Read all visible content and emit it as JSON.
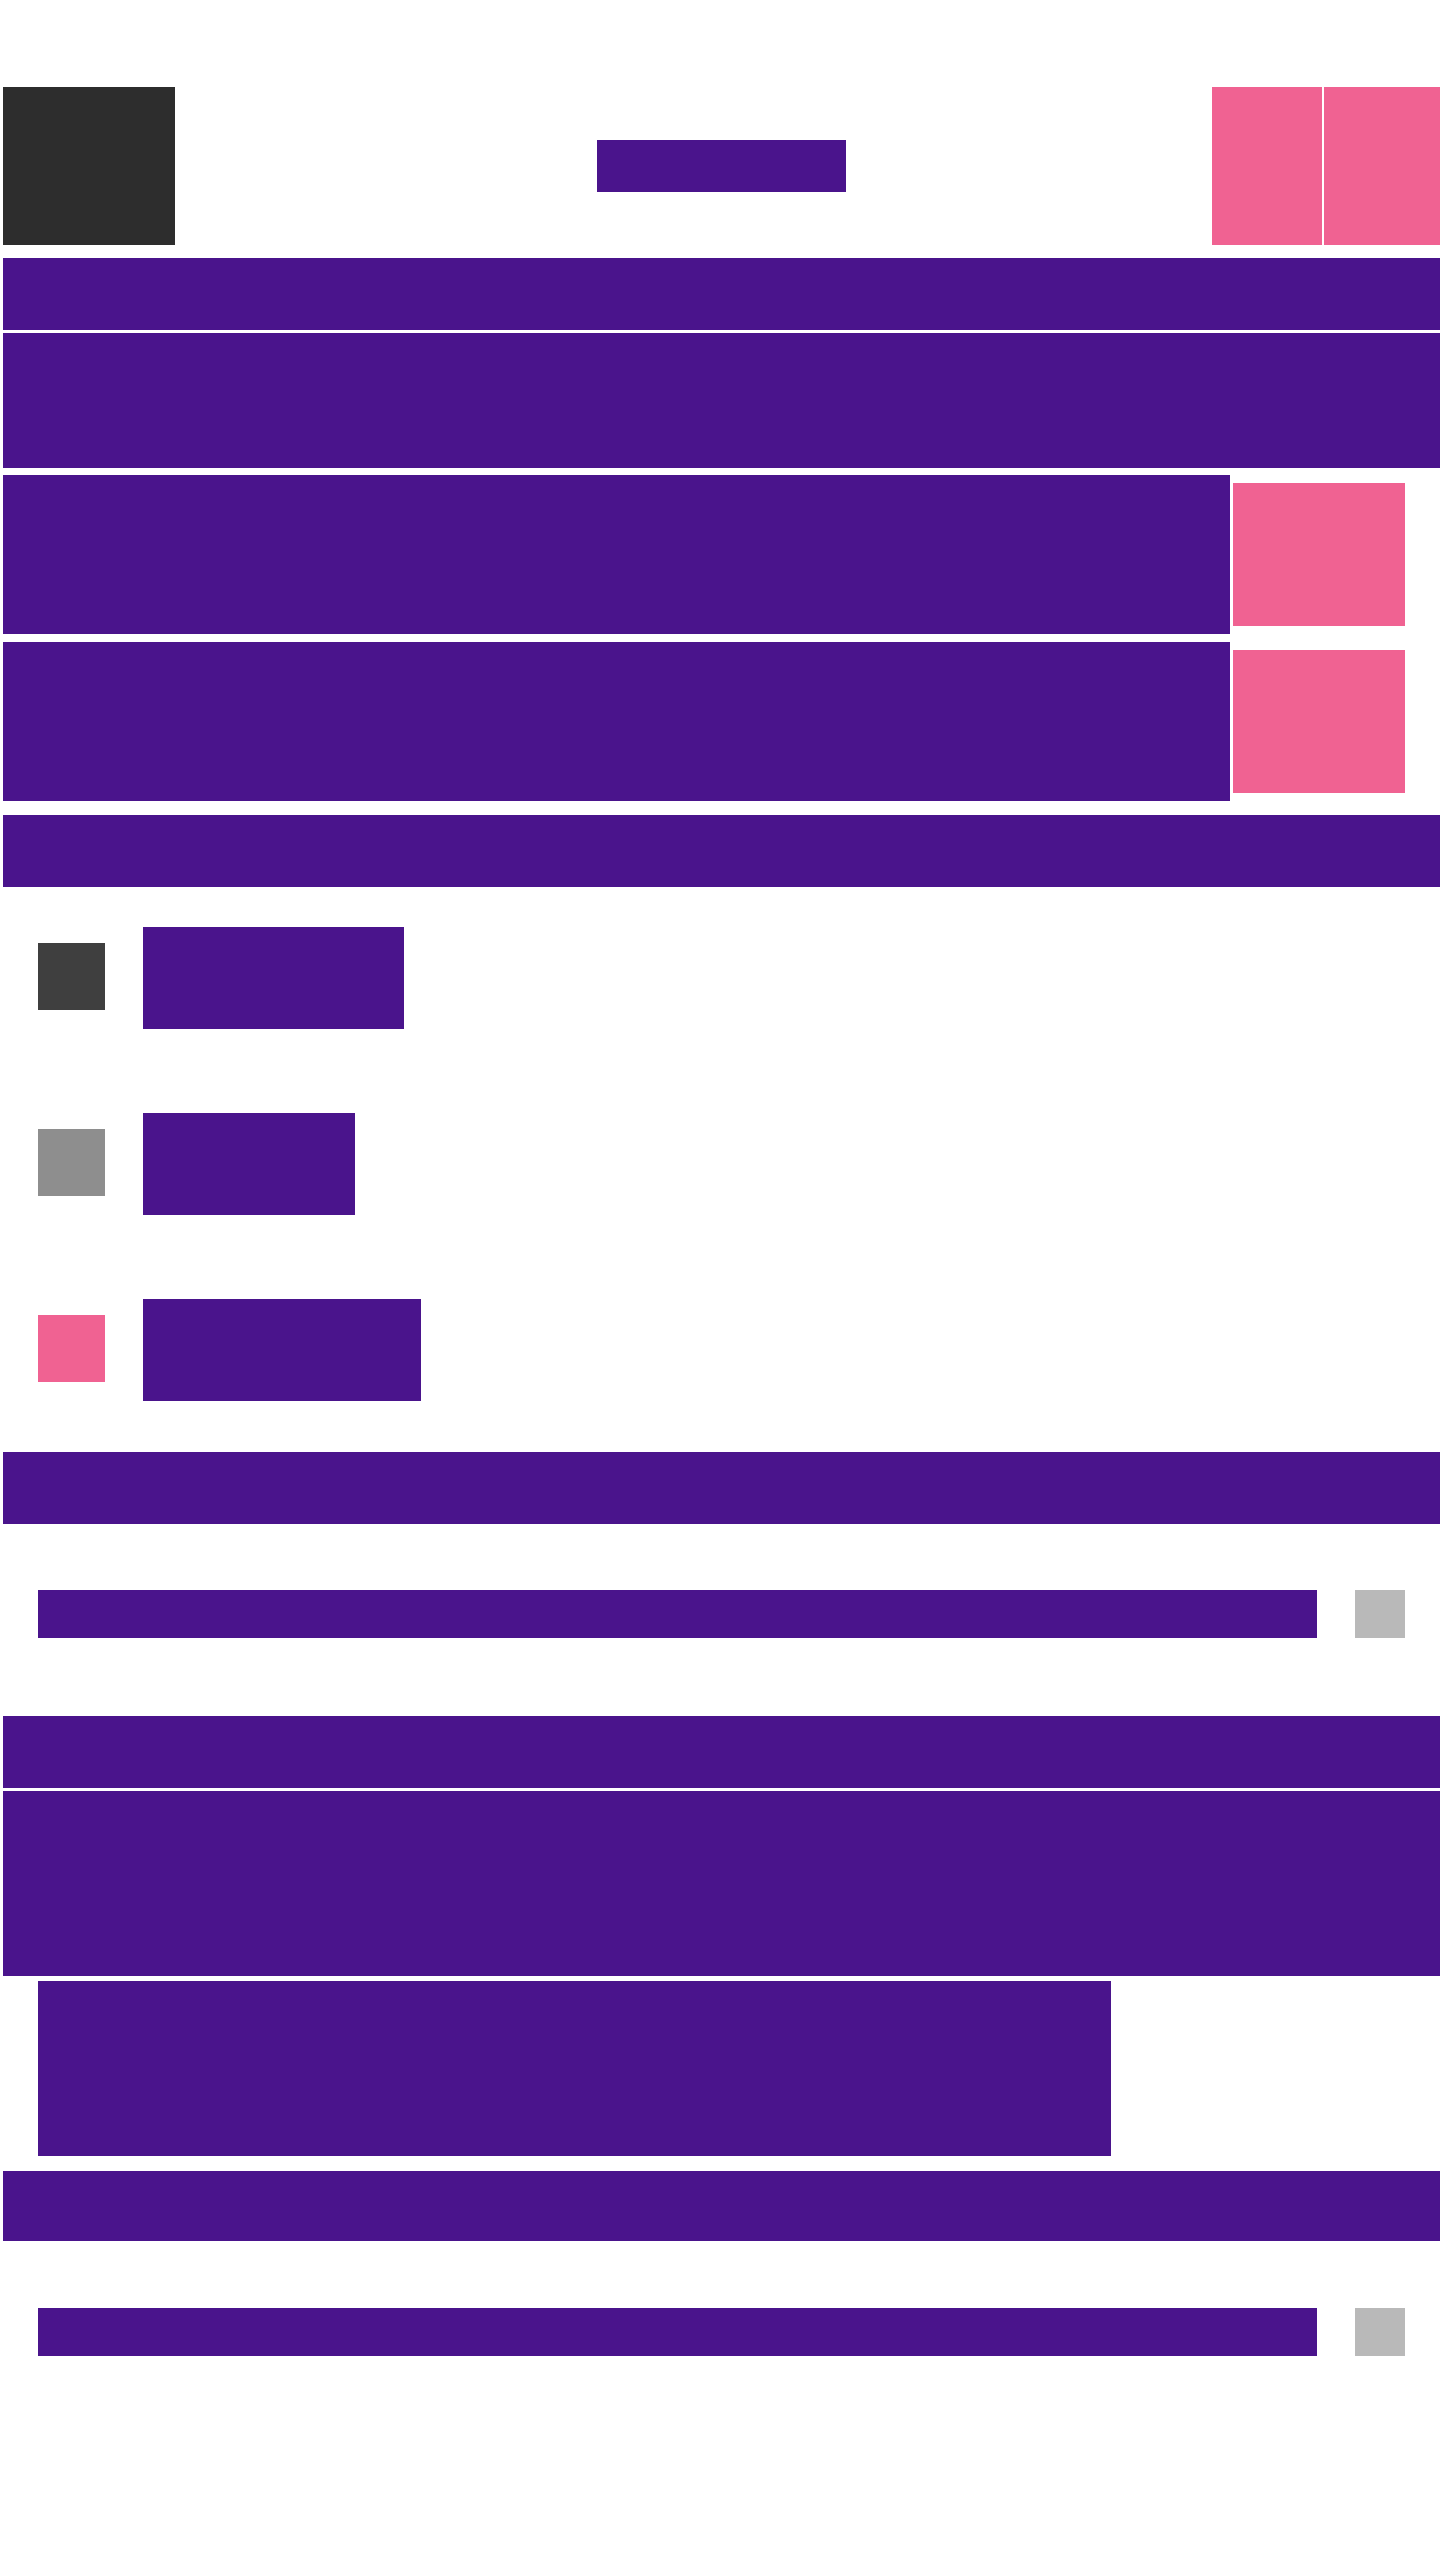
{
  "app": {
    "title": "",
    "colors": {
      "primary": "#4a148c",
      "accent": "#f06292",
      "dark": "#2d2d2d",
      "muted": "#8e8e8e",
      "disabled": "#b9b9b9",
      "background": "#ffffff"
    }
  },
  "header": {
    "title": "",
    "logo_icon": "logo-placeholder",
    "actions": [
      {
        "icon": "action-icon-1"
      },
      {
        "icon": "action-icon-2"
      }
    ]
  },
  "sections": {
    "section_1": {
      "title": ""
    },
    "banner": {
      "text": ""
    },
    "rows": [
      {
        "text": "",
        "action_icon": "action-icon"
      },
      {
        "text": "",
        "action_icon": "action-icon"
      }
    ],
    "section_2": {
      "title": ""
    },
    "legend_items": [
      {
        "label": "",
        "swatch": "#3f3f3f"
      },
      {
        "label": "",
        "swatch": "#8e8e8e"
      },
      {
        "label": "",
        "swatch": "#f06292"
      }
    ],
    "section_3": {
      "title": ""
    },
    "field_1": {
      "value": "",
      "icon": "field-icon"
    },
    "section_4": {
      "title": ""
    },
    "content_block": {
      "text": ""
    },
    "content_sub_block": {
      "text": ""
    },
    "section_5": {
      "title": ""
    },
    "field_2": {
      "value": "",
      "icon": "field-icon"
    }
  }
}
